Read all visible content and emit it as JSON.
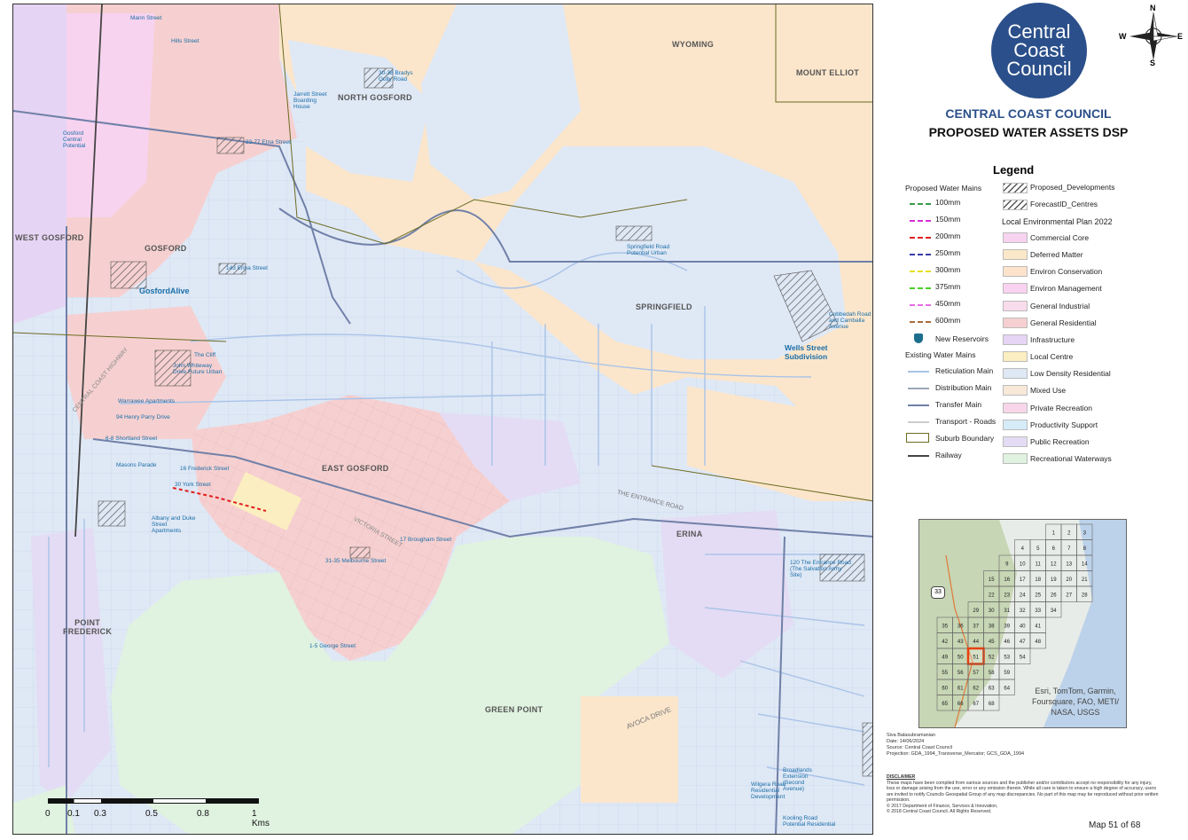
{
  "suburbs": [
    {
      "id": "wyoming",
      "label": "WYOMING"
    },
    {
      "id": "mount-elliot",
      "label": "MOUNT ELLIOT"
    },
    {
      "id": "north-gosford",
      "label": "NORTH GOSFORD"
    },
    {
      "id": "west-gosford",
      "label": "WEST GOSFORD"
    },
    {
      "id": "gosford",
      "label": "GOSFORD"
    },
    {
      "id": "springfield",
      "label": "SPRINGFIELD"
    },
    {
      "id": "east-gosford",
      "label": "EAST GOSFORD"
    },
    {
      "id": "erina",
      "label": "ERINA"
    },
    {
      "id": "point-frederick",
      "label": "POINT\nFREDERICK"
    },
    {
      "id": "green-point",
      "label": "GREEN POINT"
    }
  ],
  "developments": [
    "30-38 Bradys Gully Road",
    "Jarrett Street Boarding House",
    "Springfield Road Potential Urban",
    "Cobbedah Road and Camballa Avenue",
    "Wells Street Subdivision",
    "23-77 Etna Street",
    "143 Erina Street",
    "GosfordAlive",
    "Warrawee Apartments",
    "17 Brougham Street",
    "31-35 Melbourne Street",
    "1-5 George Street",
    "120 The Entrance Road (The Salvation Army Site)",
    "Broadlands Extension (Second Avenue)",
    "Wilgera Road Residential Development",
    "Kooling Road Potential Residential",
    "Mann Street",
    "Hills Street",
    "Gosford Central Potential",
    "The Cliff",
    "John Whiteway Drive Future Urban",
    "94 Henry Parry Drive",
    "6-8 Shortland Street",
    "16 Frederick Street",
    "30 York Street",
    "Albany and Duke Street Apartments",
    "Masons Parade"
  ],
  "road_labels": [
    "THE ENTRANCE ROAD",
    "AVOCA DRIVE",
    "VICTORIA STREET",
    "CENTRAL COAST HIGHWAY"
  ],
  "logo": {
    "line1": "Central",
    "line2": "Coast",
    "line3": "Council"
  },
  "compass": {
    "n": "N",
    "s": "S",
    "e": "E",
    "w": "W"
  },
  "header": {
    "org": "CENTRAL COAST COUNCIL",
    "title": "PROPOSED WATER ASSETS DSP"
  },
  "legend": {
    "title": "Legend",
    "proposed_heading": "Proposed Water Mains",
    "proposed": [
      {
        "label": "100mm",
        "color": "#3a9a4a"
      },
      {
        "label": "150mm",
        "color": "#d62fd6"
      },
      {
        "label": "200mm",
        "color": "#e02020"
      },
      {
        "label": "250mm",
        "color": "#3a3aa8"
      },
      {
        "label": "300mm",
        "color": "#e6e020"
      },
      {
        "label": "375mm",
        "color": "#4ad02a"
      },
      {
        "label": "450mm",
        "color": "#e86ae8"
      },
      {
        "label": "600mm",
        "color": "#a86a3a"
      }
    ],
    "reservoirs": "New Reservoirs",
    "existing_heading": "Existing Water Mains",
    "existing": [
      {
        "label": "Reticulation Main",
        "color": "#a9c3e8"
      },
      {
        "label": "Distribution Main",
        "color": "#9aa6b8"
      },
      {
        "label": "Transfer Main",
        "color": "#7080a8"
      },
      {
        "label": "Transport - Roads",
        "color": "#cccccc"
      },
      {
        "label": "Suburb Boundary",
        "color": "#6b6b22"
      },
      {
        "label": "Railway",
        "color": "#444444"
      }
    ],
    "hatch": [
      {
        "label": "Proposed_Developments"
      },
      {
        "label": "ForecastID_Centres"
      }
    ],
    "lep_heading": "Local Environmental Plan 2022",
    "lep": [
      {
        "label": "Commercial Core",
        "color": "#f7d3f0"
      },
      {
        "label": "Deferred Matter",
        "color": "#fbe8c8"
      },
      {
        "label": "Environ Conservation",
        "color": "#fde3cc"
      },
      {
        "label": "Environ Management",
        "color": "#f9d2f2"
      },
      {
        "label": "General Industrial",
        "color": "#f8dcec"
      },
      {
        "label": "General Residential",
        "color": "#f6d0d0"
      },
      {
        "label": "Infrastructure",
        "color": "#e6d4f4"
      },
      {
        "label": "Local Centre",
        "color": "#fbeec0"
      },
      {
        "label": "Low Density Residential",
        "color": "#dfe8f5"
      },
      {
        "label": "Mixed Use",
        "color": "#f8e8d8"
      },
      {
        "label": "Private Recreation",
        "color": "#f8d6ea"
      },
      {
        "label": "Productivity Support",
        "color": "#d6ecf8"
      },
      {
        "label": "Public Recreation",
        "color": "#e4dcf4"
      },
      {
        "label": "Recreational Waterways",
        "color": "#e0f2e0"
      }
    ]
  },
  "inset": {
    "attribution": "Esri, TomTom, Garmin, Foursquare, FAO, METI/ NASA, USGS",
    "highway": "33",
    "highlighted": "51",
    "rows": [
      [
        "1",
        "2",
        "3"
      ],
      [
        "4",
        "5",
        "6",
        "7",
        "8"
      ],
      [
        "9",
        "10",
        "11",
        "12",
        "13",
        "14"
      ],
      [
        "15",
        "16",
        "17",
        "18",
        "19",
        "20",
        "21"
      ],
      [
        "22",
        "23",
        "24",
        "25",
        "26",
        "27",
        "28"
      ],
      [
        "29",
        "30",
        "31",
        "32",
        "33",
        "34"
      ],
      [
        "35",
        "36",
        "37",
        "38",
        "39",
        "40",
        "41"
      ],
      [
        "42",
        "43",
        "44",
        "45",
        "46",
        "47",
        "48"
      ],
      [
        "49",
        "50",
        "51",
        "52",
        "53",
        "54"
      ],
      [
        "55",
        "56",
        "57",
        "58",
        "59"
      ],
      [
        "60",
        "61",
        "62",
        "63",
        "64"
      ],
      [
        "65",
        "66",
        "67",
        "68"
      ]
    ]
  },
  "meta": {
    "author": "Siva Balasubramanian",
    "date": "Date: 14/06/2024",
    "source": "Source: Central Coast Council",
    "projection": "Projection: GDA_1994_Transverse_Mercator; GCS_GDA_1994"
  },
  "disclaimer": {
    "heading": "DISCLAIMER",
    "text": "These maps have been compiled from various sources and the publisher and/or contributors accept no responsibility for any injury, loss or damage arising from the use, error or any omission therein. While all care is taken to ensure a high degree of accuracy, users are invited to notify Councils Geospatial Group of any map discrepancies. No part of this map may be reproduced without prior written permission.",
    "c1": "© 2017 Department of Finance, Services & Innovation,",
    "c2": "© 2018 Central Coast Council. All Rights Reserved."
  },
  "scale": {
    "ticks": [
      "0",
      "0.1",
      "0.3",
      "0.5",
      "0.8",
      "1 Kms"
    ]
  },
  "page": "Map 51 of 68"
}
